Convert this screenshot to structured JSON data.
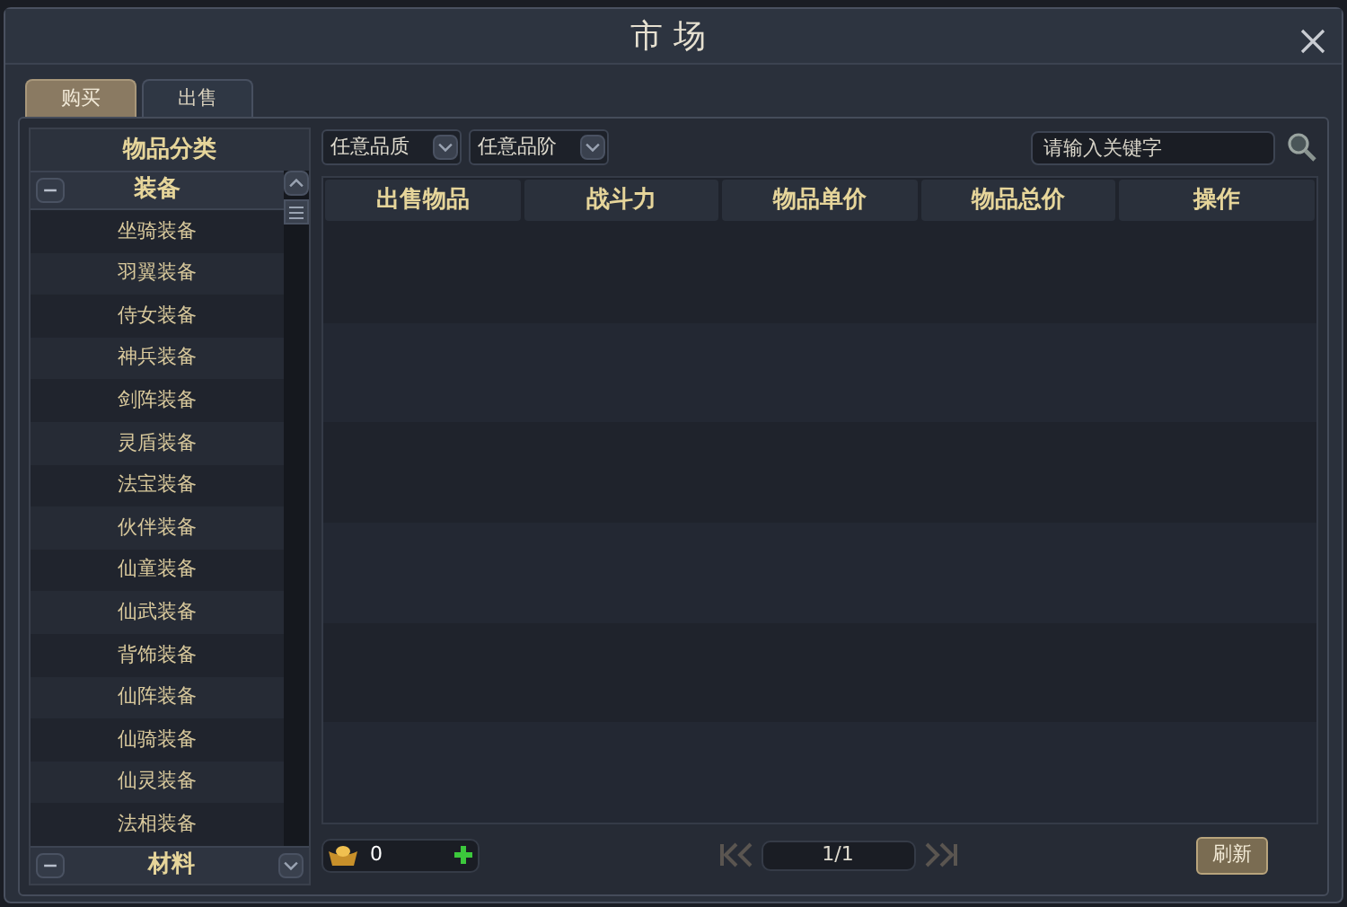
{
  "window": {
    "title": "市场"
  },
  "tabs": [
    {
      "label": "购买",
      "selected": true
    },
    {
      "label": "出售",
      "selected": false
    }
  ],
  "sidebar": {
    "title": "物品分类",
    "groups": [
      {
        "label": "装备",
        "expanded": true,
        "items": [
          "坐骑装备",
          "羽翼装备",
          "侍女装备",
          "神兵装备",
          "剑阵装备",
          "灵盾装备",
          "法宝装备",
          "伙伴装备",
          "仙童装备",
          "仙武装备",
          "背饰装备",
          "仙阵装备",
          "仙骑装备",
          "仙灵装备",
          "法相装备"
        ]
      },
      {
        "label": "材料",
        "expanded": true
      }
    ]
  },
  "filters": [
    {
      "label": "任意品质"
    },
    {
      "label": "任意品阶"
    }
  ],
  "search": {
    "placeholder": "请输入关键字"
  },
  "table": {
    "columns": [
      "出售物品",
      "战斗力",
      "物品单价",
      "物品总价",
      "操作"
    ]
  },
  "currency": {
    "amount": "0"
  },
  "pager": {
    "page": "1/1",
    "disabled": true
  },
  "buttons": [
    "刷新"
  ]
}
